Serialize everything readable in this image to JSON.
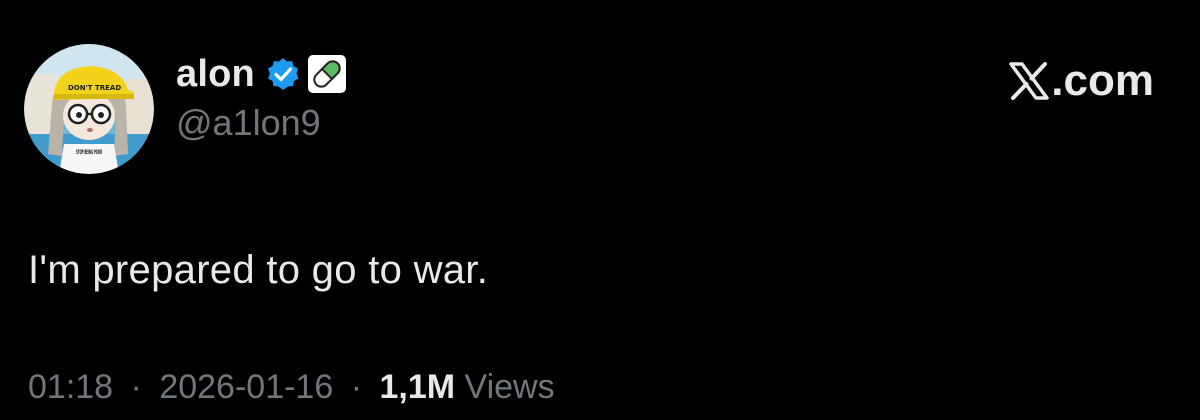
{
  "author": {
    "display_name": "alon",
    "handle": "@a1lon9",
    "verified_icon": "verified-badge-icon",
    "badge_icon": "pill-icon",
    "avatar_icon": "avatar-image",
    "avatar_cap_text": "DON'T TREAD",
    "avatar_shirt_text": "STOP BEING POOR"
  },
  "brand": {
    "logo_icon": "x-logo-icon",
    "text": ".com"
  },
  "tweet": {
    "text": "I'm prepared to go to war."
  },
  "meta": {
    "time": "01:18",
    "separator": "·",
    "date": "2026-01-16",
    "views_count": "1,1M",
    "views_label": "Views"
  },
  "colors": {
    "background": "#000000",
    "primary_text": "#e7e9ea",
    "secondary_text": "#71767b",
    "verified_blue": "#1d9bf0",
    "pill_green": "#5dbb63"
  }
}
